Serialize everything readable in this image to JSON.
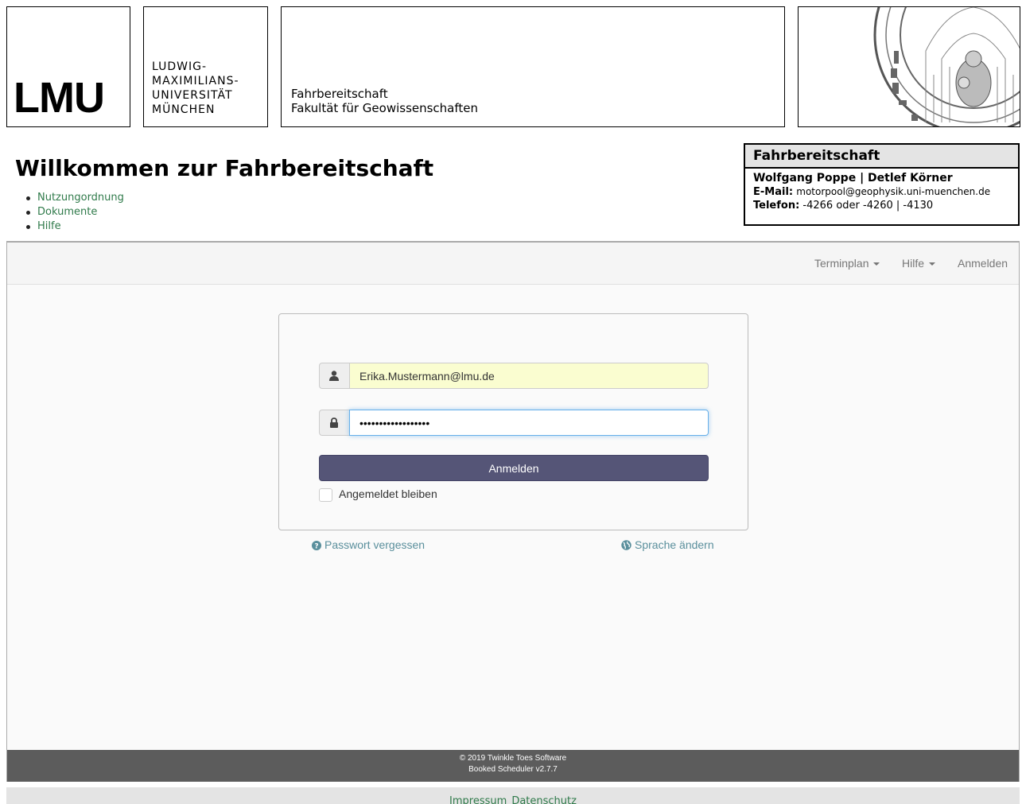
{
  "header": {
    "logo_text": "LMU",
    "university_lines": [
      "LUDWIG-",
      "MAXIMILIANS-",
      "UNIVERSITÄT",
      "MÜNCHEN"
    ],
    "department_lines": [
      "Fahrbereitschaft",
      "Fakultät für Geowissenschaften"
    ]
  },
  "welcome": {
    "title": "Willkommen zur Fahrbereitschaft",
    "links": [
      "Nutzungordnung",
      "Dokumente",
      "Hilfe"
    ]
  },
  "contact": {
    "title": "Fahrbereitschaft",
    "names": "Wolfgang Poppe | Detlef Körner",
    "email_label": "E-Mail:",
    "email": "motorpool@geophysik.uni-muenchen.de",
    "phone_label": "Telefon:",
    "phone": "-4266 oder -4260 | -4130"
  },
  "navbar": {
    "items": [
      {
        "label": "Terminplan"
      },
      {
        "label": "Hilfe"
      },
      {
        "label": "Anmelden"
      }
    ]
  },
  "login": {
    "email_value": "Erika.Mustermann@lmu.de",
    "password_value": "••••••••••••••••••",
    "submit_label": "Anmelden",
    "remember_label": "Angemeldet bleiben",
    "forgot_label": "Passwort vergessen",
    "language_label": "Sprache ändern",
    "remember_checked": false
  },
  "footer": {
    "copyright": "© 2019 Twinkle Toes Software",
    "version": "Booked Scheduler v2.7.7",
    "links": [
      "Impressum",
      "Datenschutz"
    ]
  },
  "colors": {
    "link_green": "#2f7a4a",
    "button": "#555577",
    "footer_bar": "#5c5c5c",
    "autofill_yellow": "#fafdd0"
  }
}
